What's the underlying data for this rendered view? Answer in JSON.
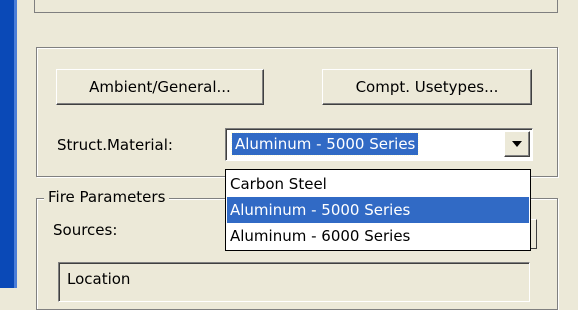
{
  "buttons": {
    "ambient_label": "Ambient/General...",
    "compt_label": "Compt. Usetypes..."
  },
  "material": {
    "label": "Struct.Material:",
    "selected": "Aluminum - 5000 Series",
    "options": [
      "Carbon Steel",
      "Aluminum - 5000 Series",
      "Aluminum - 6000 Series"
    ],
    "highlighted_index": 1
  },
  "fire": {
    "legend": "Fire Parameters",
    "sources_label": "Sources:",
    "location_label": "Location"
  },
  "colors": {
    "face": "#ece9d8",
    "selection": "#316ac5",
    "window_frame": "#0a49b7"
  }
}
